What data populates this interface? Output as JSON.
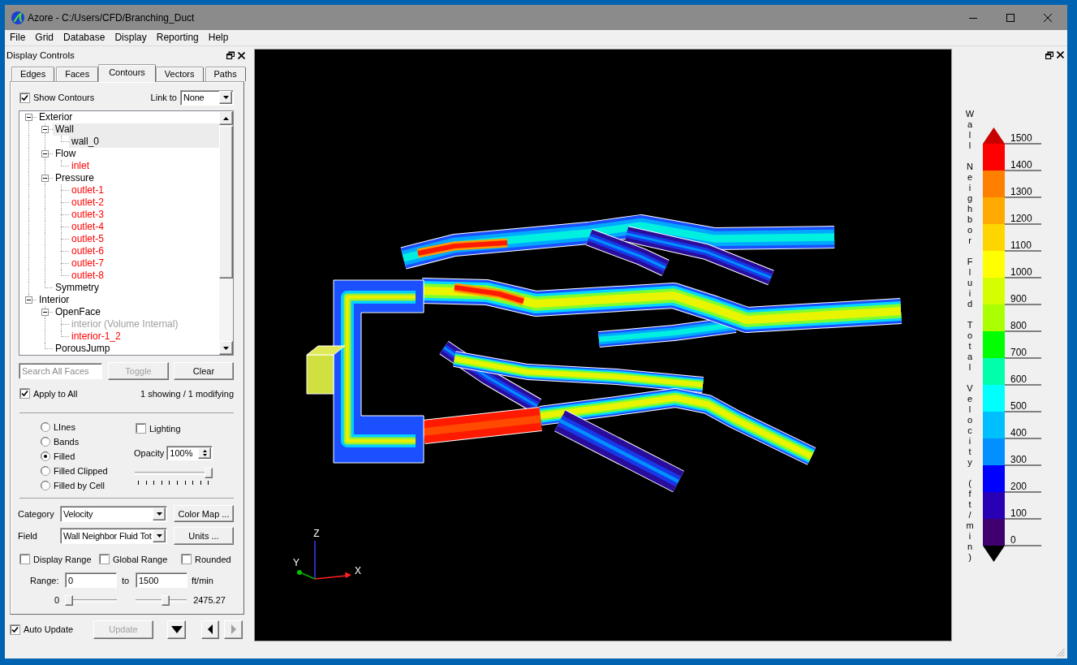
{
  "window": {
    "title": "Azore - C:/Users/CFD/Branching_Duct"
  },
  "menu": [
    "File",
    "Grid",
    "Database",
    "Display",
    "Reporting",
    "Help"
  ],
  "display_controls": {
    "title": "Display Controls",
    "tabs": [
      {
        "label": "Edges",
        "selected": false
      },
      {
        "label": "Faces",
        "selected": false
      },
      {
        "label": "Contours",
        "selected": true
      },
      {
        "label": "Vectors",
        "selected": false
      },
      {
        "label": "Paths",
        "selected": false
      }
    ],
    "show_contours": {
      "label": "Show Contours",
      "checked": true
    },
    "link_to": {
      "label": "Link to",
      "value": "None"
    },
    "tree": [
      {
        "label": "Exterior",
        "kind": "group",
        "expanded": true,
        "selected": false,
        "children": [
          {
            "label": "Wall",
            "kind": "group",
            "expanded": true,
            "selected": true,
            "children": [
              {
                "label": "wall_0",
                "kind": "face",
                "selected": true,
                "shown": true,
                "disabled": false
              }
            ]
          },
          {
            "label": "Flow",
            "kind": "group",
            "expanded": true,
            "selected": false,
            "children": [
              {
                "label": "inlet",
                "kind": "face",
                "selected": false,
                "shown": false,
                "disabled": false
              }
            ]
          },
          {
            "label": "Pressure",
            "kind": "group",
            "expanded": true,
            "selected": false,
            "children": [
              {
                "label": "outlet-1",
                "kind": "face",
                "selected": false,
                "shown": false,
                "disabled": false
              },
              {
                "label": "outlet-2",
                "kind": "face",
                "selected": false,
                "shown": false,
                "disabled": false
              },
              {
                "label": "outlet-3",
                "kind": "face",
                "selected": false,
                "shown": false,
                "disabled": false
              },
              {
                "label": "outlet-4",
                "kind": "face",
                "selected": false,
                "shown": false,
                "disabled": false
              },
              {
                "label": "outlet-5",
                "kind": "face",
                "selected": false,
                "shown": false,
                "disabled": false
              },
              {
                "label": "outlet-6",
                "kind": "face",
                "selected": false,
                "shown": false,
                "disabled": false
              },
              {
                "label": "outlet-7",
                "kind": "face",
                "selected": false,
                "shown": false,
                "disabled": false
              },
              {
                "label": "outlet-8",
                "kind": "face",
                "selected": false,
                "shown": false,
                "disabled": false
              }
            ]
          },
          {
            "label": "Symmetry",
            "kind": "group",
            "selected": false
          }
        ]
      },
      {
        "label": "Interior",
        "kind": "group",
        "expanded": true,
        "selected": false,
        "children": [
          {
            "label": "OpenFace",
            "kind": "group",
            "expanded": true,
            "selected": false,
            "children": [
              {
                "label": "interior (Volume Internal)",
                "kind": "face",
                "selected": false,
                "shown": false,
                "disabled": true
              },
              {
                "label": "interior-1_2",
                "kind": "face",
                "selected": false,
                "shown": false,
                "disabled": false
              }
            ]
          },
          {
            "label": "PorousJump",
            "kind": "group",
            "selected": false
          }
        ]
      }
    ],
    "search": {
      "placeholder": "Search All Faces"
    },
    "face_buttons": [
      {
        "label": "Toggle",
        "disabled": true
      },
      {
        "label": "Clear",
        "disabled": false
      }
    ],
    "apply_to_all": {
      "label": "Apply to All",
      "checked": true
    },
    "summary": "1 showing / 1 modifying",
    "styles": [
      {
        "label": "LInes",
        "selected": false
      },
      {
        "label": "Bands",
        "selected": false
      },
      {
        "label": "Filled",
        "selected": true
      },
      {
        "label": "Filled Clipped",
        "selected": false
      },
      {
        "label": "Filled by Cell",
        "selected": false
      }
    ],
    "lighting": {
      "label": "Lighting",
      "checked": false
    },
    "opacity": {
      "label": "Opacity",
      "value": "100%",
      "level": 1
    },
    "category": {
      "label": "Category",
      "value": "Velocity",
      "button": "Color Map ..."
    },
    "field": {
      "label": "Field",
      "value": "Wall Neighbor Fluid Tot",
      "button": "Units ..."
    },
    "range_options": [
      {
        "label": "Display Range",
        "checked": false
      },
      {
        "label": "Global Range",
        "checked": false
      },
      {
        "label": "Rounded",
        "checked": false
      }
    ],
    "range": {
      "label": "Range:",
      "from": "0",
      "separator": "to",
      "to": "1500",
      "unit": "ft/min"
    },
    "range_sliders": [
      {
        "reading": "0",
        "level": 0
      },
      {
        "reading": "2475.27",
        "level": 0.61
      }
    ]
  },
  "footer": {
    "auto_update": {
      "label": "Auto Update",
      "checked": true
    },
    "update_button": {
      "label": "Update",
      "disabled": true
    },
    "nav_buttons": [
      {
        "kind": "down",
        "disabled": false
      },
      {
        "kind": "left",
        "disabled": false
      },
      {
        "kind": "right",
        "disabled": true
      }
    ]
  },
  "viewport": {
    "axes": [
      {
        "kind": "z",
        "label": "Z"
      },
      {
        "kind": "y",
        "label": "Y"
      },
      {
        "kind": "x",
        "label": "X"
      }
    ]
  },
  "legend": {
    "title": "Wall Neighbor Fluid Total Velocity (ft/min)",
    "ticks": [
      "1500",
      "1400",
      "1300",
      "1200",
      "1100",
      "1000",
      "900",
      "800",
      "700",
      "600",
      "500",
      "400",
      "300",
      "200",
      "100",
      "0"
    ],
    "bands": [
      {
        "color": "#ff0000"
      },
      {
        "color": "#ff8000"
      },
      {
        "color": "#ffaa00"
      },
      {
        "color": "#ffd500"
      },
      {
        "color": "#ffff00"
      },
      {
        "color": "#d5ff00"
      },
      {
        "color": "#aaff00"
      },
      {
        "color": "#00ff00"
      },
      {
        "color": "#00ffaa"
      },
      {
        "color": "#00ffff"
      },
      {
        "color": "#00bfff"
      },
      {
        "color": "#0090ff"
      },
      {
        "color": "#0000ff"
      },
      {
        "color": "#2a00b5"
      },
      {
        "color": "#400070"
      }
    ]
  }
}
